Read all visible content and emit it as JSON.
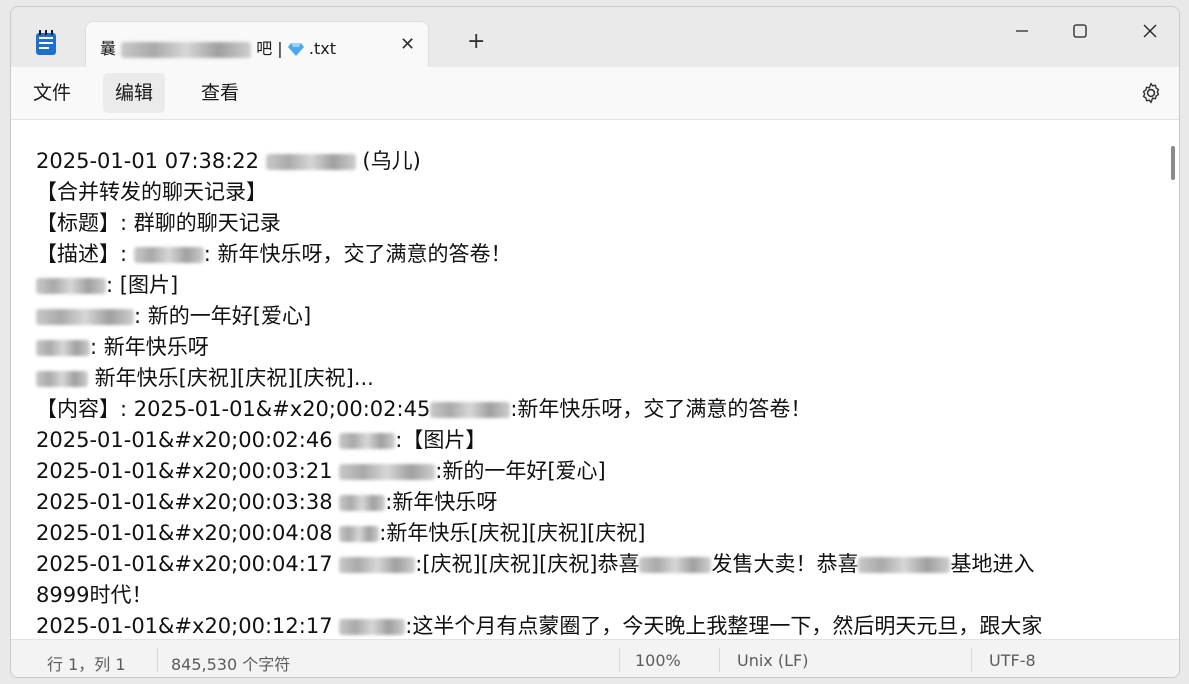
{
  "window": {
    "app_icon": "notepad-icon",
    "tab": {
      "title_prefix": "曩",
      "title_mid": "吧 |",
      "title_suffix": ".txt",
      "emoji": "gem-icon",
      "close_label": "✕"
    },
    "new_tab_label": "+",
    "controls": [
      "minimize-icon",
      "maximize-icon",
      "close-icon"
    ]
  },
  "menu": {
    "file": "文件",
    "edit": "编辑",
    "view": "查看",
    "settings_icon": "gear-icon"
  },
  "content": {
    "lines": [
      {
        "pre": "2025-01-01 07:38:22",
        "post": "(乌儿)"
      },
      {
        "pre": "【合并转发的聊天记录】",
        "post": ""
      },
      {
        "pre": "【标题】:  群聊的聊天记录",
        "post": ""
      },
      {
        "pre": "【描述】: ",
        "post": ": 新年快乐呀，交了满意的答卷！"
      },
      {
        "pre": "",
        "post": ": [图片]"
      },
      {
        "pre": "",
        "post": ": 新的一年好[爱心]"
      },
      {
        "pre": "",
        "post": ": 新年快乐呀"
      },
      {
        "pre": "",
        "post": " 新年快乐[庆祝][庆祝][庆祝]..."
      },
      {
        "pre": "【内容】:  2025-01-01&#x20;00:02:45",
        "post": ":新年快乐呀，交了满意的答卷！"
      },
      {
        "pre": "2025-01-01&#x20;00:02:46",
        "post": ":【图片】"
      },
      {
        "pre": "2025-01-01&#x20;00:03:21",
        "post": ":新的一年好[爱心]"
      },
      {
        "pre": "2025-01-01&#x20;00:03:38",
        "post": ":新年快乐呀"
      },
      {
        "pre": "2025-01-01&#x20;00:04:08",
        "post": ":新年快乐[庆祝][庆祝][庆祝]"
      },
      {
        "pre": "2025-01-01&#x20;00:04:17",
        "post": ":[庆祝][庆祝][庆祝]恭喜",
        "post2": "发售大卖！恭喜",
        "post3": "基地进入"
      },
      {
        "pre": "8999时代！",
        "post": ""
      },
      {
        "pre": "2025-01-01&#x20;00:12:17",
        "post": ":这半个月有点蒙圈了，今天晚上我整理一下，然后明天元旦，跟大家"
      }
    ]
  },
  "status": {
    "position": "行 1，列 1",
    "char_count": "845,530 个字符",
    "zoom": "100%",
    "line_ending": "Unix (LF)",
    "encoding": "UTF-8"
  }
}
